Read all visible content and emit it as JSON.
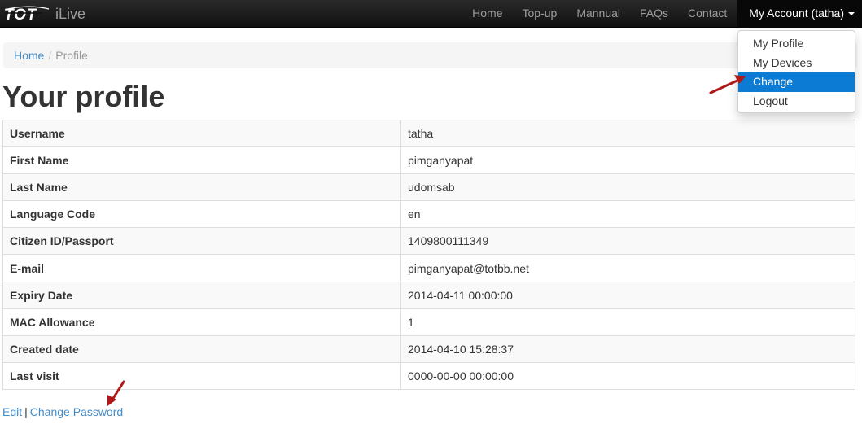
{
  "brand": {
    "name": "iLive",
    "logo_text": "TOT"
  },
  "nav": {
    "items": [
      {
        "label": "Home"
      },
      {
        "label": "Top-up"
      },
      {
        "label": "Mannual"
      },
      {
        "label": "FAQs"
      },
      {
        "label": "Contact"
      }
    ],
    "account_label": "My Account (tatha)"
  },
  "dropdown": {
    "items": [
      {
        "label": "My Profile"
      },
      {
        "label": "My Devices"
      },
      {
        "label": "Change Password",
        "selected": true
      },
      {
        "label": "Logout"
      }
    ]
  },
  "breadcrumb": {
    "home": "Home",
    "separator": "/",
    "current": "Profile"
  },
  "page": {
    "title": "Your profile"
  },
  "profile": {
    "rows": [
      {
        "label": "Username",
        "value": "tatha"
      },
      {
        "label": "First Name",
        "value": "pimganyapat"
      },
      {
        "label": "Last Name",
        "value": "udomsab"
      },
      {
        "label": "Language Code",
        "value": "en"
      },
      {
        "label": "Citizen ID/Passport",
        "value": "1409800111349"
      },
      {
        "label": "E-mail",
        "value": "pimganyapat@totbb.net"
      },
      {
        "label": "Expiry Date",
        "value": "2014-04-11 00:00:00"
      },
      {
        "label": "MAC Allowance",
        "value": "1"
      },
      {
        "label": "Created date",
        "value": "2014-04-10 15:28:37"
      },
      {
        "label": "Last visit",
        "value": "0000-00-00 00:00:00"
      }
    ]
  },
  "footer": {
    "edit_label": "Edit",
    "separator": "|",
    "change_password_label": "Change Password"
  },
  "colors": {
    "link": "#428bca",
    "navbar": "#111111",
    "dropdown_active": "#0b7bd3",
    "annotation_arrow": "#b01818"
  }
}
